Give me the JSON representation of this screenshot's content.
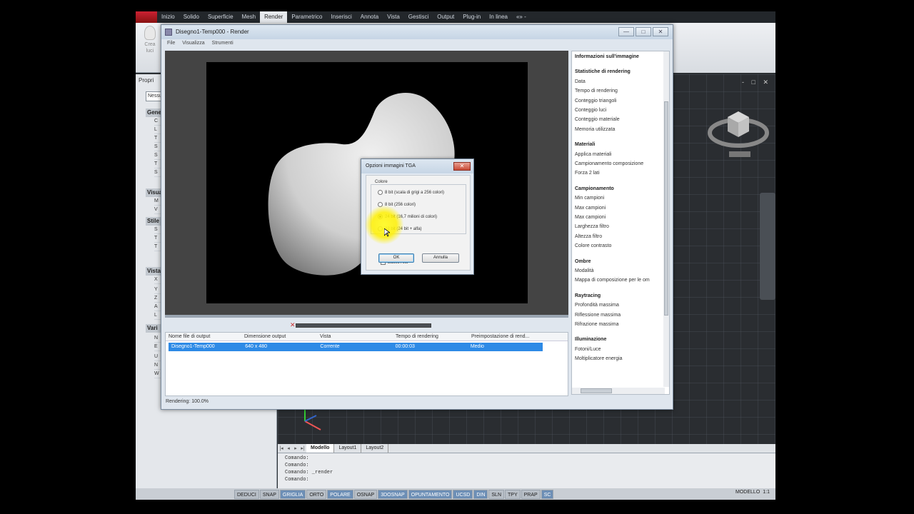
{
  "ribbon_tabs": [
    "Inizio",
    "Solido",
    "Superficie",
    "Mesh",
    "Render",
    "Parametrico",
    "Inserisci",
    "Annota",
    "Vista",
    "Gestisci",
    "Output",
    "Plug-in",
    "In linea",
    "«» -"
  ],
  "active_tab_index": 4,
  "ribbon": {
    "create_label_1": "Crea",
    "create_label_2": "luci"
  },
  "properties": {
    "title": "Propri",
    "combo": "Nessu",
    "sections": [
      "Gene",
      "Visua",
      "Stile",
      "Vista",
      "Vari"
    ],
    "rows": [
      "C",
      "L",
      "T",
      "S",
      "S",
      "T",
      "S",
      "M",
      "V",
      "S",
      "T",
      "T",
      "X",
      "Y",
      "Z",
      "A",
      "L",
      "N",
      "E",
      "U",
      "N",
      "W"
    ]
  },
  "render_window": {
    "title": "Disegno1-Temp000 - Render",
    "menu": [
      "File",
      "Visualizza",
      "Strumenti"
    ],
    "list_headers": [
      "Nome file di output",
      "Dimensione output",
      "Vista",
      "Tempo di rendering",
      "Preimpostazione di rend..."
    ],
    "list_row": [
      "Disegno1-Temp000",
      "640 x 480",
      "Corrente",
      "00:00:03",
      "Medio"
    ],
    "progress": 1.0,
    "status": "Rendering: 100.0%",
    "controls": [
      "—",
      "□",
      "✕"
    ]
  },
  "info_panel": {
    "items": [
      {
        "t": "Informazioni sull'immagine",
        "h": true
      },
      {
        "t": "Statistiche di rendering",
        "h": true
      },
      {
        "t": "Data",
        "h": false
      },
      {
        "t": "Tempo di rendering",
        "h": false
      },
      {
        "t": "Conteggio triangoli",
        "h": false
      },
      {
        "t": "Conteggio luci",
        "h": false
      },
      {
        "t": "Conteggio materiale",
        "h": false
      },
      {
        "t": "Memoria utilizzata",
        "h": false
      },
      {
        "t": "Materiali",
        "h": true
      },
      {
        "t": "Applica materiali",
        "h": false
      },
      {
        "t": "Campionamento composizione",
        "h": false
      },
      {
        "t": "Forza 2 lati",
        "h": false
      },
      {
        "t": "Campionamento",
        "h": true
      },
      {
        "t": "Min campioni",
        "h": false
      },
      {
        "t": "Max campioni",
        "h": false
      },
      {
        "t": "Max campioni",
        "h": false
      },
      {
        "t": "Larghezza filtro",
        "h": false
      },
      {
        "t": "Altezza filtro",
        "h": false
      },
      {
        "t": "Colore contrasto",
        "h": false
      },
      {
        "t": "Ombre",
        "h": true
      },
      {
        "t": "Modalità",
        "h": false
      },
      {
        "t": "Mappa di composizione per le om",
        "h": false
      },
      {
        "t": "Raytracing",
        "h": true
      },
      {
        "t": "Profondità massima",
        "h": false
      },
      {
        "t": "Riflessione massima",
        "h": false
      },
      {
        "t": "Rifrazione massima",
        "h": false
      },
      {
        "t": "Illuminazione",
        "h": true
      },
      {
        "t": "Fotoni/Luce",
        "h": false
      },
      {
        "t": "Moltiplicatore energia",
        "h": false
      }
    ]
  },
  "tga_dialog": {
    "title": "Opzioni immagini TGA",
    "group_label": "Colore",
    "options": [
      "8 bit (scala di grigi a 256 colori)",
      "8 bit (256 colori)",
      "24 bit (16,7 milioni di colori)",
      "32 bit (24 bit + alfa)"
    ],
    "selected_index": 2,
    "checkbox_label": "Basso Alto",
    "ok_label": "OK",
    "cancel_label": "Annulla"
  },
  "layout_tabs": [
    "Modello",
    "Layout1",
    "Layout2"
  ],
  "command_lines": [
    "Comando:",
    "Comando:",
    "Comando:  _render",
    "Comando:"
  ],
  "status_toggles": [
    {
      "t": "DEDUCI",
      "on": false
    },
    {
      "t": "SNAP",
      "on": false
    },
    {
      "t": "GRIGLIA",
      "on": true
    },
    {
      "t": "ORTO",
      "on": false
    },
    {
      "t": "POLARE",
      "on": true
    },
    {
      "t": "OSNAP",
      "on": false
    },
    {
      "t": "3DOSNAP",
      "on": true
    },
    {
      "t": "OPUNTAMENTO",
      "on": true
    },
    {
      "t": "UCSD",
      "on": true
    },
    {
      "t": "DIN",
      "on": true
    },
    {
      "t": "SLN",
      "on": false
    },
    {
      "t": "TPY",
      "on": false
    },
    {
      "t": "PRAP",
      "on": false
    },
    {
      "t": "SC",
      "on": true
    }
  ],
  "status_right": {
    "model": "MODELLO",
    "scale": "1:1"
  },
  "viewport_controls": "-  □  ✕",
  "colors": {
    "selection": "#2e8ae6",
    "highlight": "#fff028",
    "close_button": "#c84a36"
  }
}
